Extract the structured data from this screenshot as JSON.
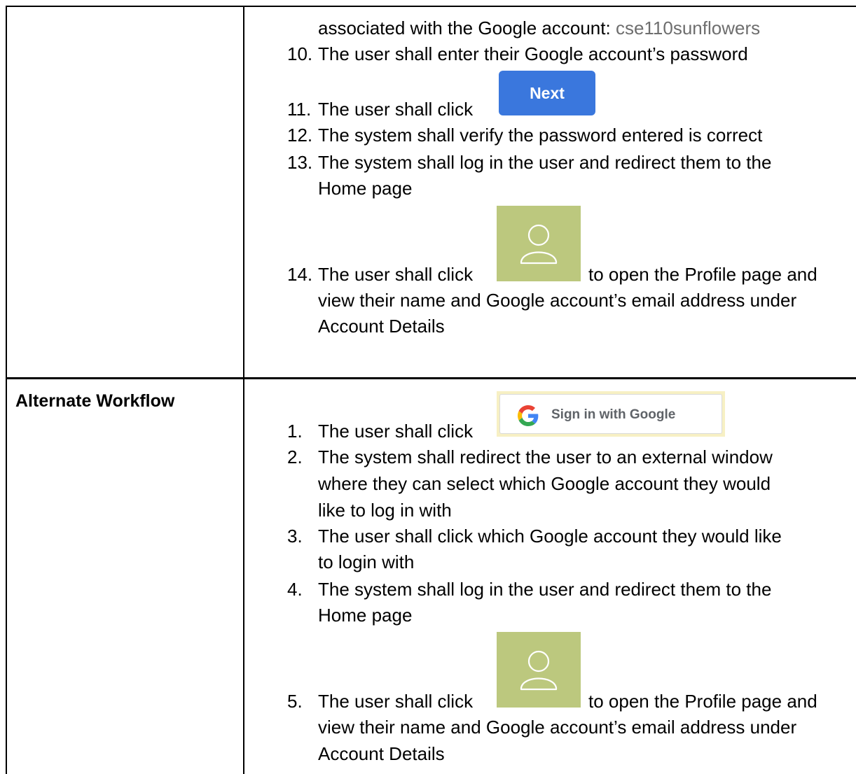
{
  "alternate": {
    "label": "Alternate Workflow",
    "steps": [
      {
        "num": "1.",
        "text": "The user shall click"
      },
      {
        "num": "2.",
        "lines": [
          "The system shall redirect the user to an external window",
          "where they can select which Google account they would",
          "like to log in with"
        ]
      },
      {
        "num": "3.",
        "lines": [
          "The user shall click which Google account they would like",
          "to login with"
        ]
      },
      {
        "num": "4.",
        "lines": [
          "The system shall log in the user and redirect them to the",
          "Home page"
        ]
      },
      {
        "num": "5.",
        "text": "The user shall click",
        "after": "to open the Profile page and",
        "lines": [
          "view their name and Google account’s email address under",
          "Account Details"
        ]
      }
    ],
    "google_button_label": "Sign in with Google"
  },
  "main": {
    "step9_continuation": "associated with the Google account: ",
    "account_email": "cse110sunflowers",
    "steps": [
      {
        "num": "10.",
        "text": "The user shall enter their Google account’s password"
      },
      {
        "num": "11.",
        "text": "The user shall click"
      },
      {
        "num": "12.",
        "text": "The system shall verify the password entered is correct"
      },
      {
        "num": "13.",
        "lines": [
          "The system shall log in the user and redirect them to the",
          "Home page"
        ]
      },
      {
        "num": "14.",
        "text": "The user shall click",
        "after": "to open the Profile page and",
        "lines": [
          "view their name and Google account’s email address under",
          "Account Details"
        ]
      }
    ],
    "next_button_label": "Next"
  },
  "icons": {
    "profile": "user-profile-icon",
    "google": "google-g-icon"
  },
  "colors": {
    "next_button": "#3a77dd",
    "profile_tile": "#bcc87e",
    "google_button_highlight": "#f7f0c4",
    "account_text": "#6e6e6e"
  }
}
